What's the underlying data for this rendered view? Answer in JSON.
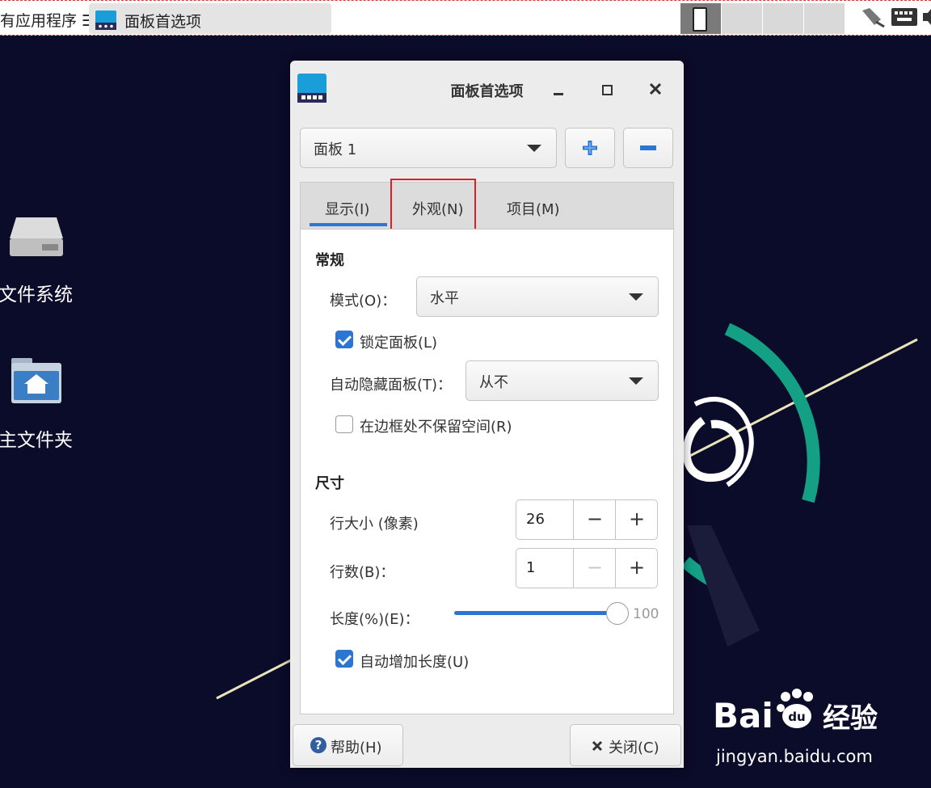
{
  "top_panel": {
    "apps_menu_label": "有应用程序 ☰",
    "task_button_label": "面板首选项"
  },
  "desktop": {
    "icons": [
      {
        "label": "文件系统",
        "icon": "drive-icon"
      },
      {
        "label": "主文件夹",
        "icon": "home-folder-icon"
      }
    ]
  },
  "dialog": {
    "title": "面板首选项",
    "panel_select_value": "面板 1",
    "add_panel": "+",
    "remove_panel": "−",
    "tabs": [
      {
        "label": "显示(I)"
      },
      {
        "label": "外观(N)"
      },
      {
        "label": "项目(M)"
      }
    ],
    "general": {
      "section_title": "常规",
      "mode_label": "模式(O)：",
      "mode_value": "水平",
      "lock_panel_label": "锁定面板(L)",
      "lock_panel_checked": true,
      "autohide_label": "自动隐藏面板(T)：",
      "autohide_value": "从不",
      "reserve_space_label": "在边框处不保留空间(R)",
      "reserve_space_checked": false
    },
    "size": {
      "section_title": "尺寸",
      "row_size_label": "行大小 (像素)",
      "row_size_value": "26",
      "rows_label": "行数(B)：",
      "rows_value": "1",
      "length_label": "长度(%)(E)：",
      "length_value": "100",
      "auto_length_label": "自动增加长度(U)",
      "auto_length_checked": true
    },
    "help_button": "帮助(H)",
    "close_button": "关闭(C)"
  },
  "watermark": {
    "brand": "Bai  经验",
    "url": "jingyan.baidu.com"
  },
  "colors": {
    "accent": "#2a76d2",
    "highlight": "#e02020",
    "desktop_bg": "#0b0b2a",
    "debian_teal": "#14a085"
  }
}
